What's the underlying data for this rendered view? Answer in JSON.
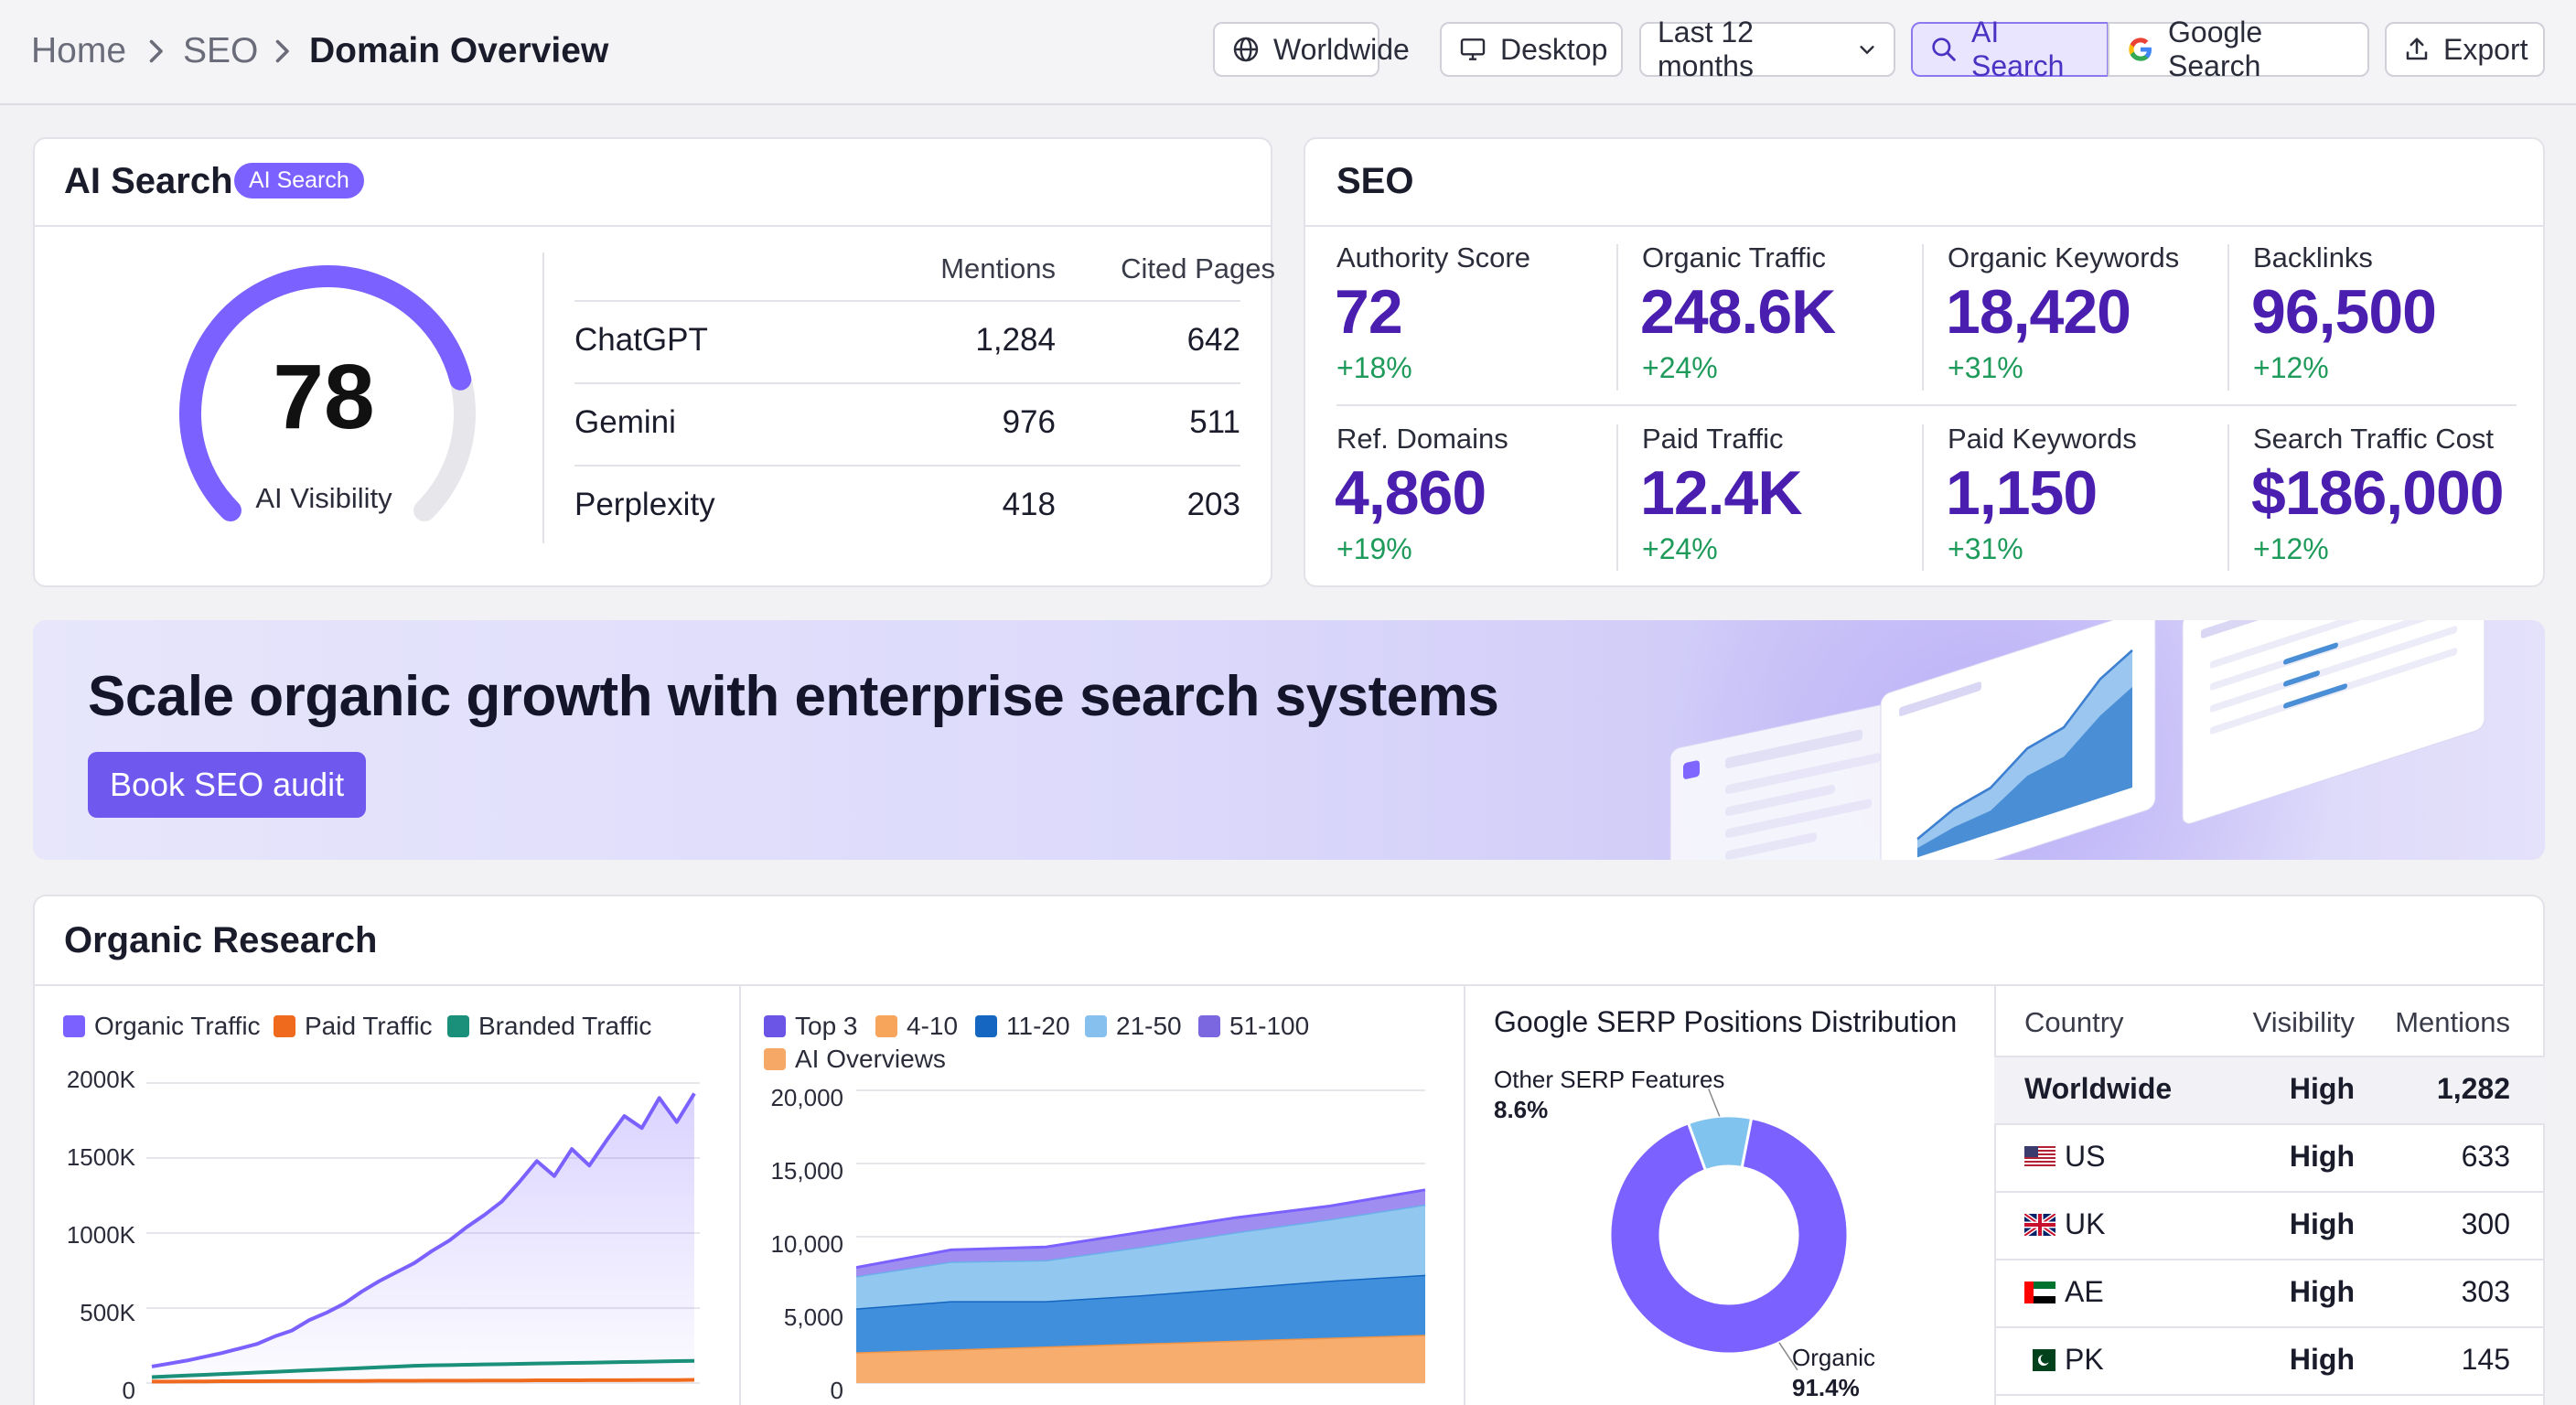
{
  "breadcrumb": {
    "home": "Home",
    "seo": "SEO",
    "current": "Domain Overview"
  },
  "toolbar": {
    "worldwide": "Worldwide",
    "device": "Desktop",
    "period": "Last 12 months",
    "ai_search": "AI Search",
    "google_search": "Google Search",
    "export": "Export"
  },
  "ai_card": {
    "title": "AI Search",
    "badge": "AI Search",
    "score": "78",
    "score_label": "AI Visibility",
    "gauge_fraction": 0.78,
    "headers": {
      "mentions": "Mentions",
      "cited": "Cited Pages"
    },
    "rows": [
      {
        "name": "ChatGPT",
        "mentions": "1,284",
        "cited": "642"
      },
      {
        "name": "Gemini",
        "mentions": "976",
        "cited": "511"
      },
      {
        "name": "Perplexity",
        "mentions": "418",
        "cited": "203"
      }
    ]
  },
  "seo_card": {
    "title": "SEO",
    "metrics": [
      {
        "label": "Authority Score",
        "value": "72",
        "delta": "+18%"
      },
      {
        "label": "Organic Traffic",
        "value": "248.6K",
        "delta": "+24%"
      },
      {
        "label": "Organic Keywords",
        "value": "18,420",
        "delta": "+31%"
      },
      {
        "label": "Backlinks",
        "value": "96,500",
        "delta": "+12%"
      },
      {
        "label": "Ref. Domains",
        "value": "4,860",
        "delta": "+19%"
      },
      {
        "label": "Paid Traffic",
        "value": "12.4K",
        "delta": "+24%"
      },
      {
        "label": "Paid Keywords",
        "value": "1,150",
        "delta": "+31%"
      },
      {
        "label": "Search Traffic Cost",
        "value": "$186,000",
        "delta": "+12%"
      }
    ]
  },
  "banner": {
    "title": "Scale organic growth with enterprise search systems",
    "button": "Book SEO audit"
  },
  "organic": {
    "title": "Organic Research"
  },
  "colors": {
    "accent": "#7b61ff",
    "metric_value": "#4a1fb0",
    "delta_green": "#1e9a5a",
    "organic_traffic": "#7b61ff",
    "paid_traffic": "#f06a1d",
    "branded_traffic": "#1a8f7a"
  },
  "chart_data": [
    {
      "type": "line",
      "legend": [
        "Organic Traffic",
        "Paid Traffic",
        "Branded Traffic"
      ],
      "y_ticks": [
        "2000K",
        "1500K",
        "1000K",
        "500K",
        "0"
      ],
      "ylim": [
        0,
        2000
      ],
      "series": [
        {
          "name": "Organic Traffic",
          "values": [
            110,
            130,
            150,
            175,
            200,
            230,
            260,
            310,
            350,
            420,
            470,
            530,
            610,
            680,
            740,
            800,
            880,
            950,
            1040,
            1120,
            1210,
            1340,
            1480,
            1380,
            1560,
            1450,
            1620,
            1780,
            1700,
            1900,
            1740,
            1930
          ]
        },
        {
          "name": "Paid Traffic",
          "values": [
            10,
            10,
            11,
            11,
            12,
            12,
            12,
            13,
            13,
            13,
            14,
            14,
            14,
            15,
            15,
            15,
            16,
            16,
            16,
            17,
            17,
            17,
            18,
            18,
            18,
            19,
            19,
            19,
            20,
            20,
            20,
            21
          ]
        },
        {
          "name": "Branded Traffic",
          "values": [
            40,
            45,
            50,
            55,
            60,
            65,
            70,
            75,
            80,
            85,
            90,
            95,
            100,
            105,
            110,
            115,
            118,
            120,
            122,
            124,
            126,
            128,
            130,
            132,
            134,
            136,
            138,
            140,
            142,
            144,
            146,
            148
          ]
        }
      ]
    },
    {
      "type": "area",
      "legend": [
        "Top 3",
        "4-10",
        "11-20",
        "21-50",
        "51-100",
        "AI Overviews"
      ],
      "y_ticks": [
        "20,000",
        "15,000",
        "10,000",
        "5,000",
        "0"
      ],
      "ylim": [
        0,
        20000
      ],
      "x": [
        0,
        1,
        2,
        3,
        4,
        5,
        6
      ],
      "series": [
        {
          "name": "AI Overviews",
          "values": [
            2100,
            2300,
            2500,
            2700,
            2900,
            3100,
            3300
          ]
        },
        {
          "name": "11-20",
          "values": [
            3000,
            3300,
            3100,
            3300,
            3600,
            3900,
            4100
          ]
        },
        {
          "name": "21-50",
          "values": [
            2200,
            2700,
            2800,
            3300,
            3800,
            4200,
            4800
          ]
        },
        {
          "name": "51-100",
          "values": [
            600,
            800,
            900,
            1000,
            1000,
            900,
            1000
          ]
        }
      ]
    },
    {
      "type": "pie",
      "title": "Google SERP Positions Distribution",
      "slices": [
        {
          "name": "Organic",
          "value": 91.4,
          "label": "Organic",
          "pct": "91.4%"
        },
        {
          "name": "Other SERP Features",
          "value": 8.6,
          "label": "Other SERP Features",
          "pct": "8.6%"
        }
      ]
    },
    {
      "type": "table",
      "headers": [
        "Country",
        "Visibility",
        "Mentions"
      ],
      "rows": [
        {
          "country": "Worldwide",
          "visibility": "High",
          "mentions": "1,282"
        },
        {
          "country": "US",
          "visibility": "High",
          "mentions": "633"
        },
        {
          "country": "UK",
          "visibility": "High",
          "mentions": "300"
        },
        {
          "country": "AE",
          "visibility": "High",
          "mentions": "303"
        },
        {
          "country": "PK",
          "visibility": "High",
          "mentions": "145"
        }
      ]
    }
  ]
}
